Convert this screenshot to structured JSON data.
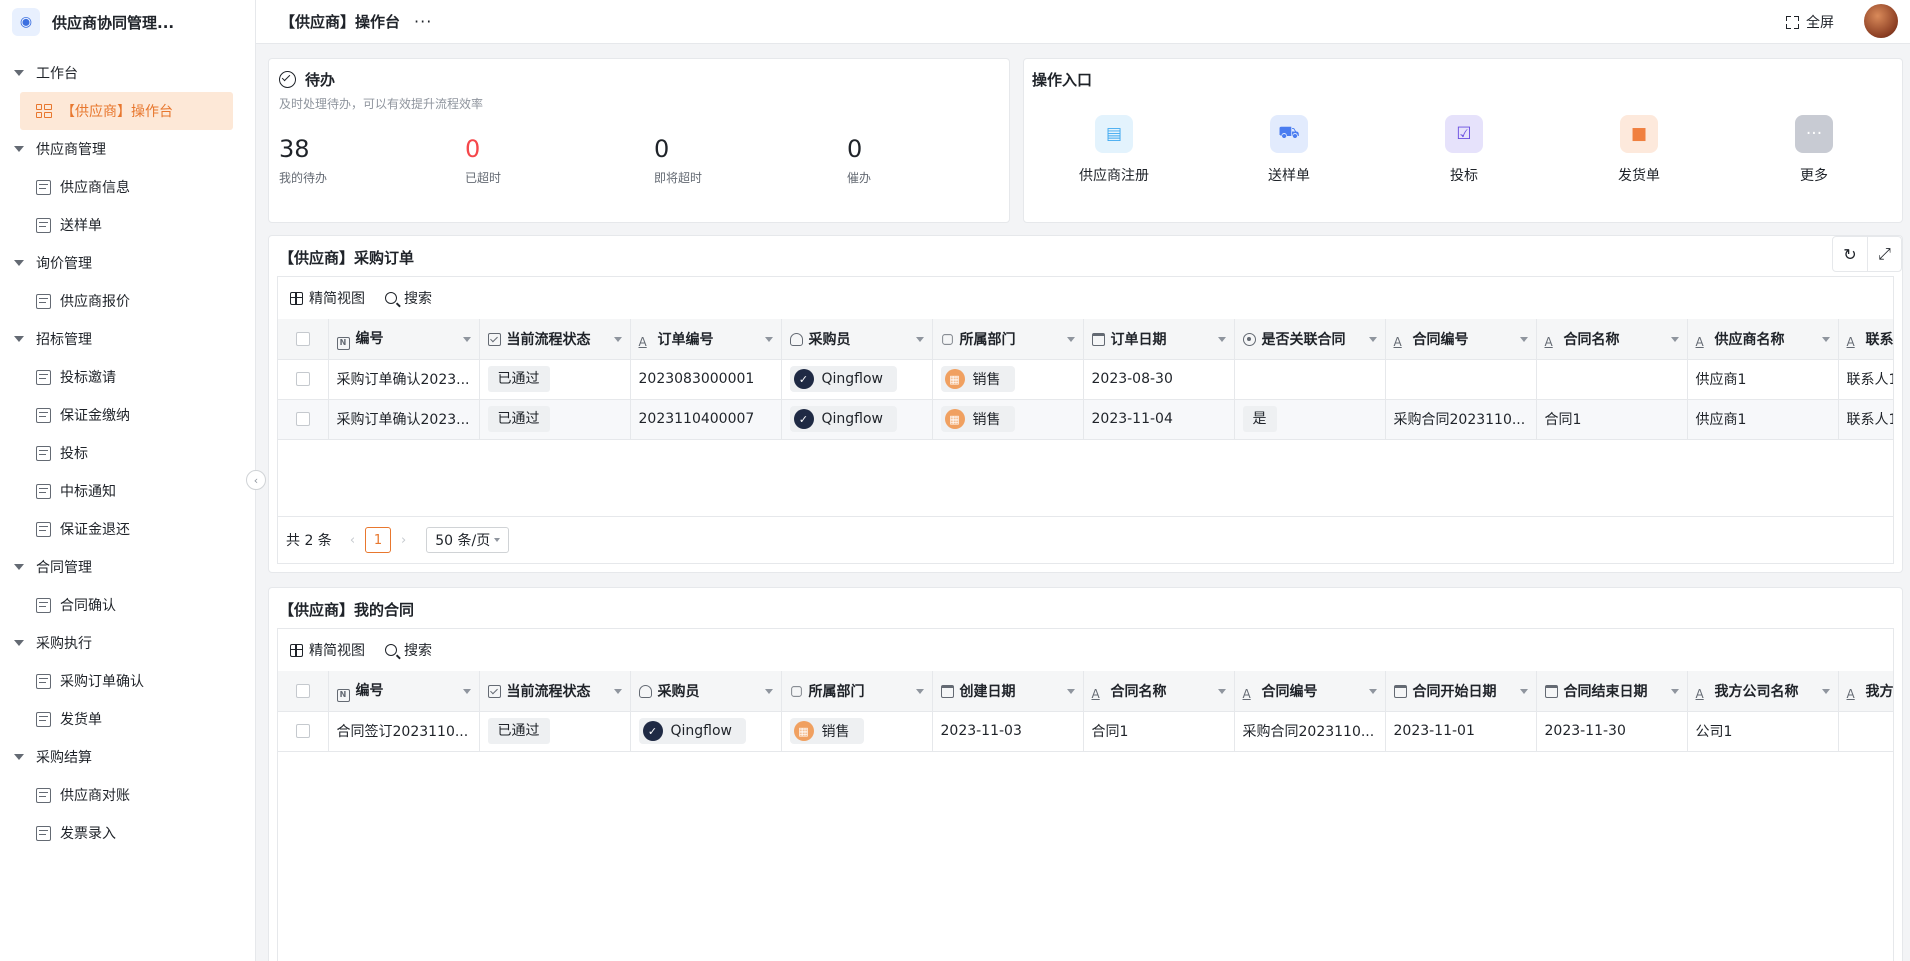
{
  "app": {
    "name": "供应商协同管理...",
    "logo_icon": "team-icon"
  },
  "topbar": {
    "title": "【供应商】操作台",
    "more": "···",
    "fullscreen_label": "全屏"
  },
  "sidebar": {
    "groups": [
      {
        "label": "工作台",
        "items": [
          {
            "label": "【供应商】操作台",
            "active": true
          }
        ]
      },
      {
        "label": "供应商管理",
        "items": [
          {
            "label": "供应商信息"
          },
          {
            "label": "送样单"
          }
        ]
      },
      {
        "label": "询价管理",
        "items": [
          {
            "label": "供应商报价"
          }
        ]
      },
      {
        "label": "招标管理",
        "items": [
          {
            "label": "投标邀请"
          },
          {
            "label": "保证金缴纳"
          },
          {
            "label": "投标"
          },
          {
            "label": "中标通知"
          },
          {
            "label": "保证金退还"
          }
        ]
      },
      {
        "label": "合同管理",
        "items": [
          {
            "label": "合同确认"
          }
        ]
      },
      {
        "label": "采购执行",
        "items": [
          {
            "label": "采购订单确认"
          },
          {
            "label": "发货单"
          }
        ]
      },
      {
        "label": "采购结算",
        "items": [
          {
            "label": "供应商对账"
          },
          {
            "label": "发票录入"
          }
        ]
      }
    ]
  },
  "todo": {
    "title": "待办",
    "subtitle": "及时处理待办，可以有效提升流程效率",
    "stats": [
      {
        "value": "38",
        "label": "我的待办"
      },
      {
        "value": "0",
        "label": "已超时",
        "highlight": true
      },
      {
        "value": "0",
        "label": "即将超时"
      },
      {
        "value": "0",
        "label": "催办"
      }
    ]
  },
  "entry": {
    "title": "操作入口",
    "items": [
      {
        "label": "供应商注册",
        "icon": "id-card-icon",
        "bg": "#e3f3fd",
        "color": "#3fa9f0"
      },
      {
        "label": "送样单",
        "icon": "truck-icon",
        "bg": "#e2ebfd",
        "color": "#4a7cf0"
      },
      {
        "label": "投标",
        "icon": "clipboard-icon",
        "bg": "#e6e2fb",
        "color": "#6a4fe0"
      },
      {
        "label": "发货单",
        "icon": "delivery-icon",
        "bg": "#fde9dc",
        "color": "#f08040"
      },
      {
        "label": "更多",
        "icon": "more-icon",
        "bg": "#c8cbd3",
        "color": "#ffffff"
      }
    ]
  },
  "toolbar": {
    "view_label": "精简视图",
    "search_label": "搜索"
  },
  "orders": {
    "title": "【供应商】采购订单",
    "columns": [
      "编号",
      "当前流程状态",
      "订单编号",
      "采购员",
      "所属部门",
      "订单日期",
      "是否关联合同",
      "合同编号",
      "合同名称",
      "供应商名称",
      "联系人"
    ],
    "rows": [
      {
        "id": "采购订单确认2023...",
        "status": "已通过",
        "order_no": "2023083000001",
        "buyer": "Qingflow",
        "dept": "销售",
        "date": "2023-08-30",
        "linked": "",
        "contract_no": "",
        "contract_name": "",
        "supplier": "供应商1",
        "contact": "联系人1"
      },
      {
        "id": "采购订单确认2023...",
        "status": "已通过",
        "order_no": "2023110400007",
        "buyer": "Qingflow",
        "dept": "销售",
        "date": "2023-11-04",
        "linked": "是",
        "contract_no": "采购合同2023110...",
        "contract_name": "合同1",
        "supplier": "供应商1",
        "contact": "联系人1"
      }
    ],
    "pager": {
      "total": "共 2 条",
      "current": "1",
      "page_size": "50 条/页"
    }
  },
  "contracts": {
    "title": "【供应商】我的合同",
    "columns": [
      "编号",
      "当前流程状态",
      "采购员",
      "所属部门",
      "创建日期",
      "合同名称",
      "合同编号",
      "合同开始日期",
      "合同结束日期",
      "我方公司名称",
      "我方公"
    ],
    "rows": [
      {
        "id": "合同签订2023110...",
        "status": "已通过",
        "buyer": "Qingflow",
        "dept": "销售",
        "created": "2023-11-03",
        "name": "合同1",
        "no": "采购合同2023110...",
        "start": "2023-11-01",
        "end": "2023-11-30",
        "company": "公司1",
        "company2": ""
      }
    ]
  }
}
